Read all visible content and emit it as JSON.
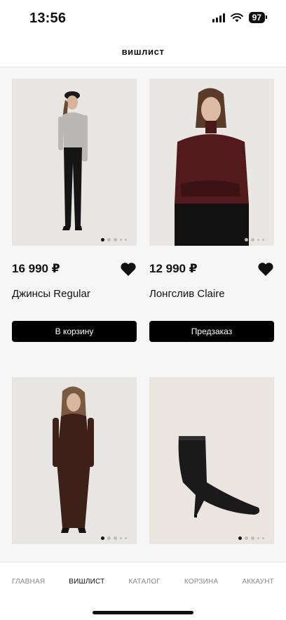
{
  "status": {
    "time": "13:56",
    "battery": "97"
  },
  "header": {
    "title": "вишлист"
  },
  "products": [
    {
      "price": "16 990 ₽",
      "name": "Джинсы Regular",
      "button": "В корзину"
    },
    {
      "price": "12 990 ₽",
      "name": "Лонгслив Claire",
      "button": "Предзаказ"
    }
  ],
  "tabbar": {
    "items": [
      {
        "label": "ГЛАВНАЯ"
      },
      {
        "label": "ВИШЛИСТ"
      },
      {
        "label": "КАТАЛОГ"
      },
      {
        "label": "КОРЗИНА"
      },
      {
        "label": "АККАУНТ"
      }
    ],
    "active": "ВИШЛИСТ"
  },
  "colors": {
    "accent": "#000000",
    "background": "#f6f6f6"
  },
  "icons": [
    "signal-icon",
    "wifi-icon",
    "battery-icon",
    "heart-icon"
  ]
}
